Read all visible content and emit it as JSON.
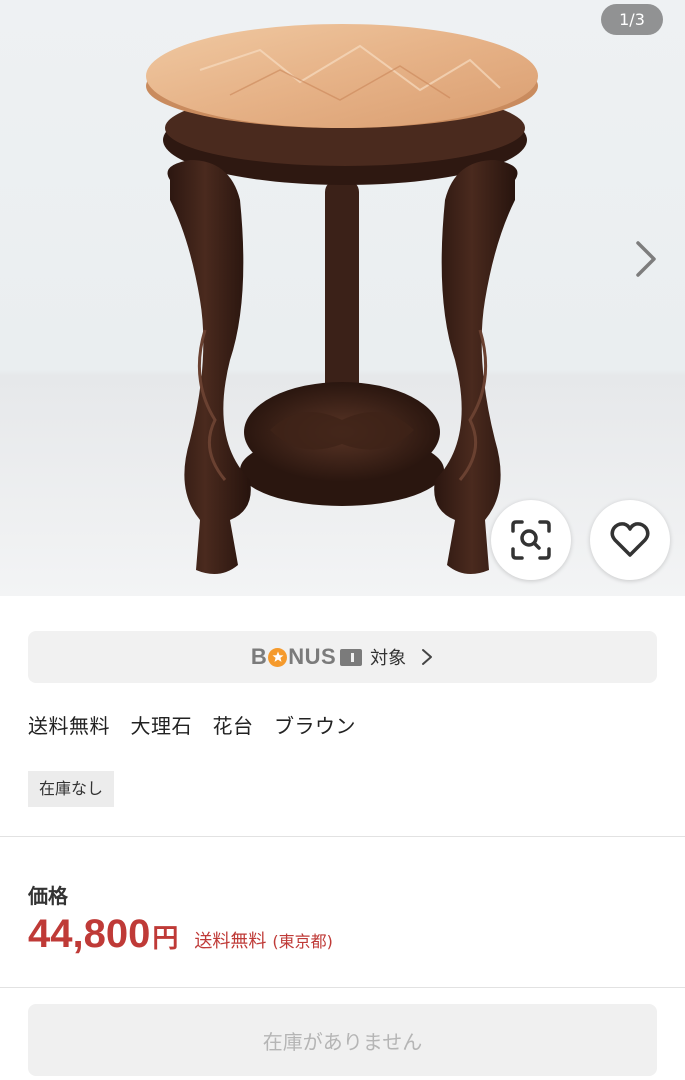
{
  "gallery": {
    "counter": "1/3",
    "icons": {
      "next": "chevron-right-icon",
      "zoom": "image-search-icon",
      "favorite": "heart-icon"
    }
  },
  "bonus": {
    "logo_pre": "B",
    "logo_post": "NUS",
    "target_label": "対象",
    "colors": {
      "star": "#f59a2c",
      "logo": "#7b7b7b"
    }
  },
  "product": {
    "title": "送料無料　大理石　花台　ブラウン",
    "stock_badge": "在庫なし"
  },
  "price": {
    "label": "価格",
    "value": "44,800",
    "unit": "円",
    "shipping": "送料無料",
    "location": "(東京都)",
    "color": "#bf3a37"
  },
  "actions": {
    "soldout_label": "在庫がありません"
  }
}
